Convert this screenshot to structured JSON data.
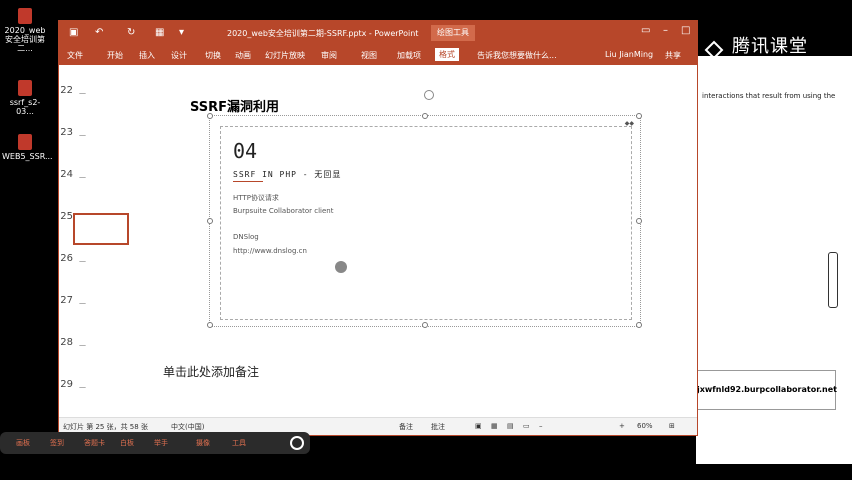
{
  "desktop": {
    "icons": [
      {
        "label": "2020_web安全培训第二...",
        "icon": "pptx-file-icon"
      },
      {
        "label": "ssrf_s2-03...",
        "icon": "pptx-file-icon"
      },
      {
        "label": "WEB5_SSR...",
        "icon": "pptx-file-icon"
      }
    ]
  },
  "background_window": {
    "text_line": "interactions that result from using the",
    "collaborator": "jxwfnld92.burpcollaborator.net"
  },
  "watermark": {
    "text": "腾讯课堂"
  },
  "ppt": {
    "title": "2020_web安全培训第二期-SSRF.pptx - PowerPoint",
    "tools_label": "绘图工具",
    "tabs": [
      "文件",
      "开始",
      "插入",
      "设计",
      "切换",
      "动画",
      "幻灯片放映",
      "审阅",
      "视图",
      "加载项",
      "格式"
    ],
    "active_tab": "格式",
    "tell_me": "告诉我您想要做什么...",
    "user": "Liu JianMing",
    "share": "共享",
    "thumb_numbers": [
      "22",
      "23",
      "24",
      "25",
      "26",
      "27",
      "28",
      "29"
    ],
    "slide": {
      "title": "SSRF漏洞利用",
      "number": "04",
      "subtitle": "SSRF IN PHP - 无回显",
      "line1": "HTTP协议请求",
      "line2": "Burpsuite Collaborator client",
      "line3": "DNSlog",
      "line4": "http://www.dnslog.cn"
    },
    "notes_placeholder": "单击此处添加备注",
    "status": {
      "slide_info": "幻灯片 第 25 张，共 58 张",
      "language": "中文(中国)",
      "notes_btn": "备注",
      "comments_btn": "批注",
      "zoom": "60%"
    }
  },
  "taskbar": {
    "items": [
      "画板",
      "签到",
      "答题卡",
      "白板",
      "举手",
      "摄像",
      "工具"
    ]
  }
}
